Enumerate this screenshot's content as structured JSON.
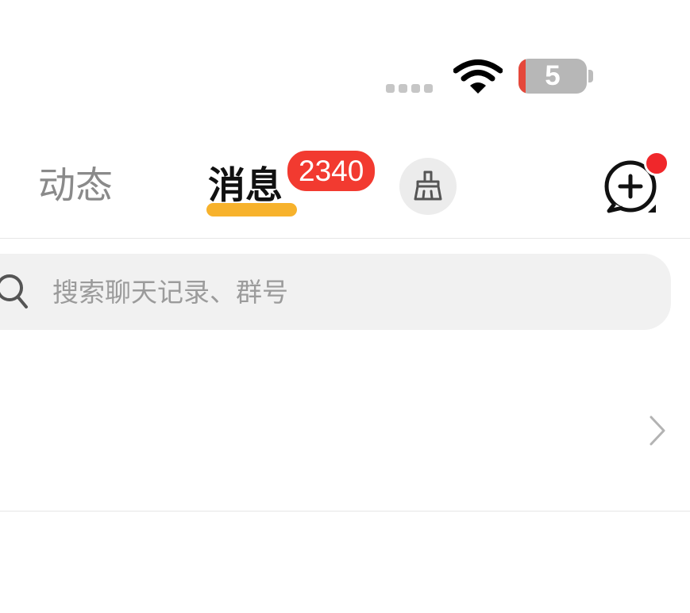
{
  "status_bar": {
    "signal_icon": "signal-dots-icon",
    "wifi_icon": "wifi-icon",
    "battery_level_text": "5",
    "battery_fraction": 0.05,
    "battery_color": "#e5483b"
  },
  "header": {
    "tabs": [
      {
        "label": "动态",
        "active": false
      },
      {
        "label": "消息",
        "active": true
      }
    ],
    "unread_badge": "2340",
    "clean_icon": "broom-icon",
    "new_chat_icon": "chat-add-icon",
    "accent_color": "#f7b22c",
    "badge_color": "#f23a30"
  },
  "search": {
    "placeholder": "搜索聊天记录、群号",
    "value": "",
    "icon": "search-icon"
  },
  "list": {
    "rows": [
      {
        "chevron_icon": "chevron-right-icon"
      }
    ]
  }
}
